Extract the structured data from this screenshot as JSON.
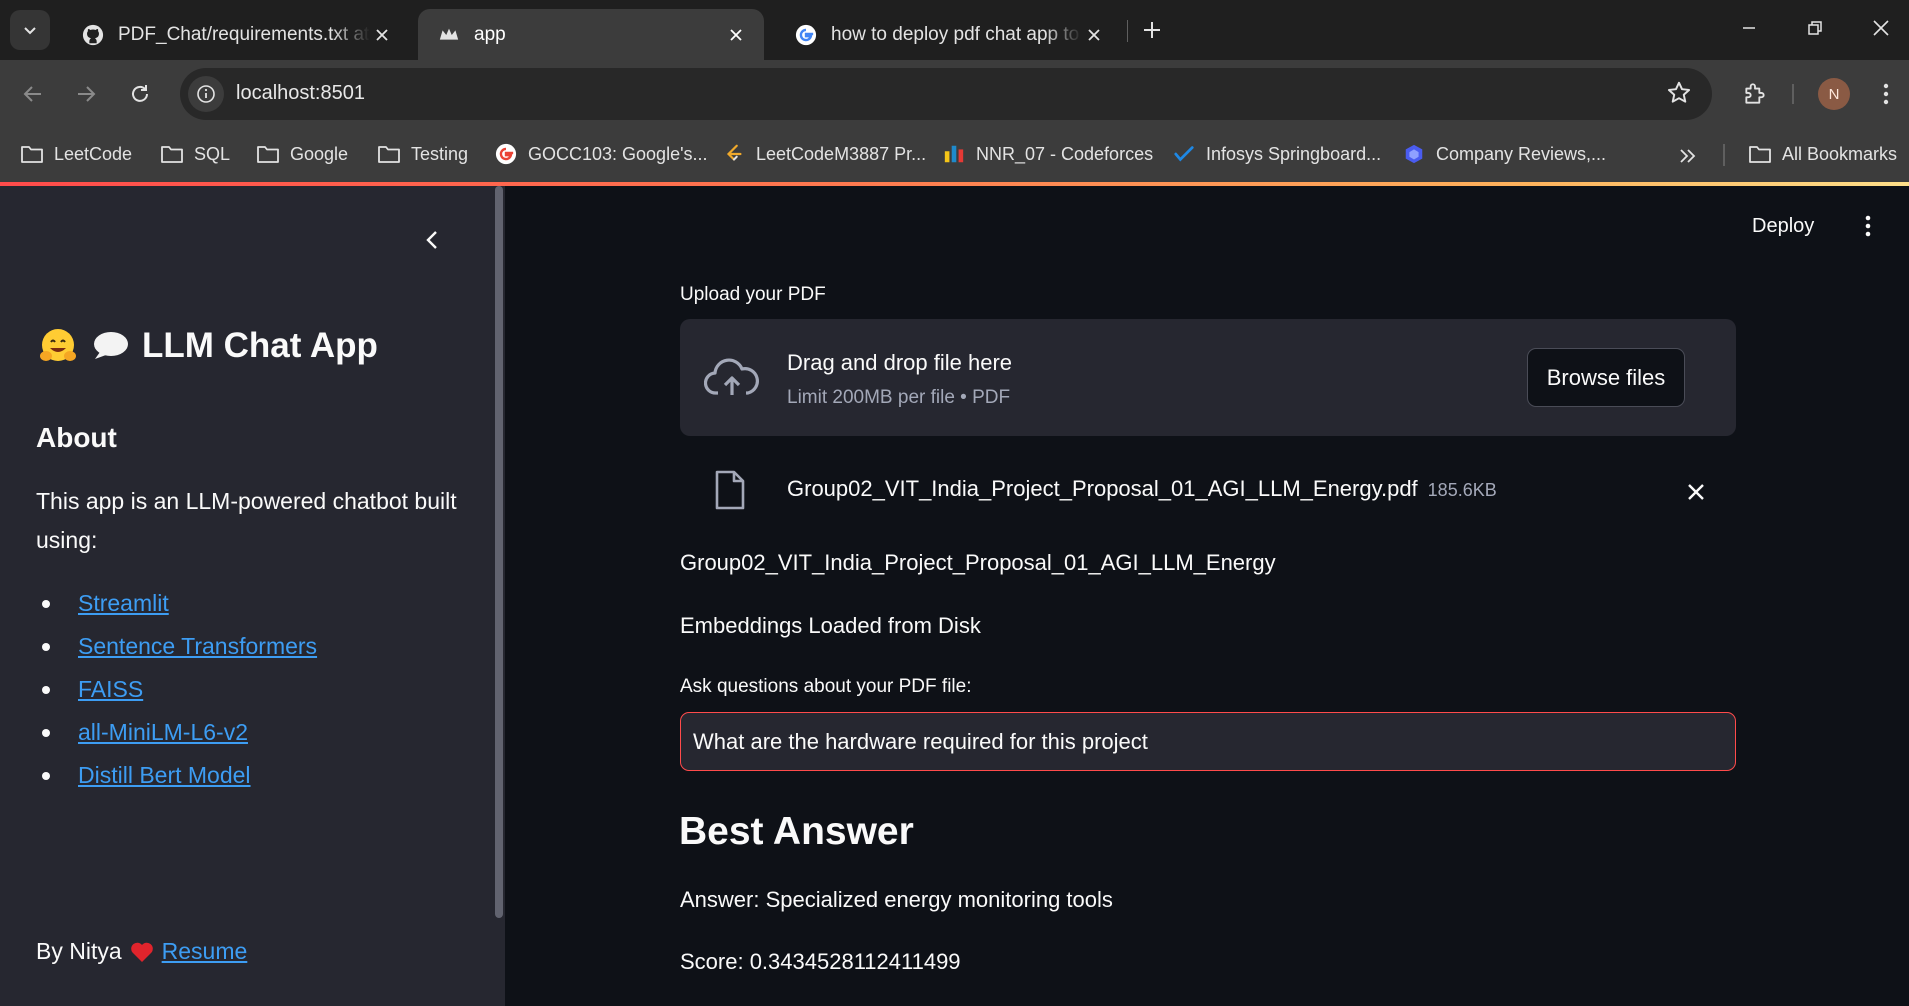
{
  "browser": {
    "tabs": [
      {
        "title": "PDF_Chat/requirements.txt at m",
        "icon": "github-icon",
        "active": false
      },
      {
        "title": "app",
        "icon": "streamlit-crown-icon",
        "active": true
      },
      {
        "title": "how to deploy pdf chat app to",
        "icon": "google-icon",
        "active": false
      }
    ],
    "url": "localhost:8501",
    "profile_initial": "N",
    "bookmarks": [
      {
        "label": "LeetCode",
        "icon": "folder-icon"
      },
      {
        "label": "SQL",
        "icon": "folder-icon"
      },
      {
        "label": "Google",
        "icon": "folder-icon"
      },
      {
        "label": "Testing",
        "icon": "folder-icon"
      },
      {
        "label": "GOCC103: Google's...",
        "icon": "google-icon"
      },
      {
        "label": "LeetCodeM3887 Pr...",
        "icon": "leetcode-icon"
      },
      {
        "label": "NNR_07 - Codeforces",
        "icon": "codeforces-icon"
      },
      {
        "label": "Infosys Springboard...",
        "icon": "infosys-icon"
      },
      {
        "label": "Company Reviews,...",
        "icon": "company-icon"
      }
    ],
    "all_bookmarks": "All Bookmarks"
  },
  "sidebar": {
    "title": "LLM Chat App",
    "about_heading": "About",
    "about_text": "This app is an LLM-powered chatbot built using:",
    "links": [
      "Streamlit",
      "Sentence Transformers",
      "FAISS",
      "all-MiniLM-L6-v2",
      "Distill Bert Model"
    ],
    "footer_prefix": "By Nitya",
    "footer_link": "Resume"
  },
  "main": {
    "deploy": "Deploy",
    "upload_label": "Upload your PDF",
    "dropzone_title": "Drag and drop file here",
    "dropzone_sub": "Limit 200MB per file • PDF",
    "browse": "Browse files",
    "file_name": "Group02_VIT_India_Project_Proposal_01_AGI_LLM_Energy.pdf",
    "file_size": "185.6KB",
    "doc_name": "Group02_VIT_India_Project_Proposal_01_AGI_LLM_Energy",
    "status": "Embeddings Loaded from Disk",
    "question_label": "Ask questions about your PDF file:",
    "question_value": "What are the hardware required for this project",
    "answer_heading": "Best Answer",
    "answer": "Answer: Specialized energy monitoring tools",
    "score": "Score: 0.3434528112411499"
  },
  "colors": {
    "accent": "#ff4b4b",
    "link": "#3d9df3",
    "sidebar_bg": "#262730",
    "main_bg": "#0e1117"
  }
}
